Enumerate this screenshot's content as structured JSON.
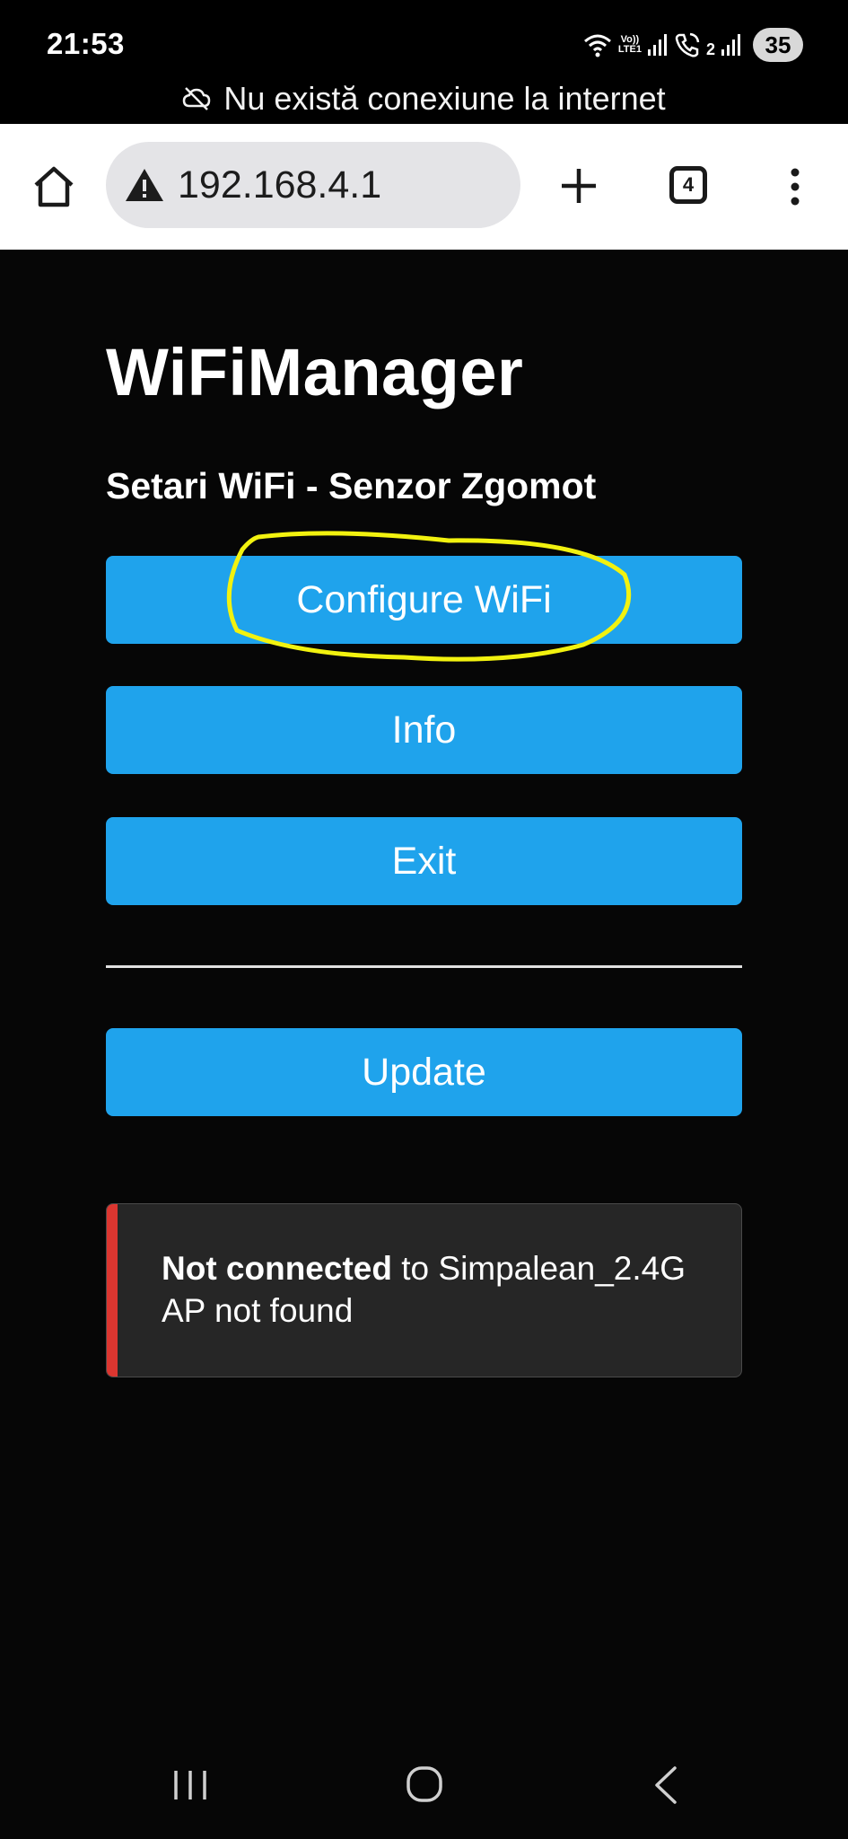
{
  "status_bar": {
    "time": "21:53",
    "battery": "35",
    "volte_top": "Vo))",
    "volte_bottom": "LTE1",
    "sim2_label": "2",
    "icons": [
      "wifi-icon",
      "volte-icon",
      "signal-icon",
      "wifi-calling-icon",
      "signal-icon",
      "battery-icon"
    ]
  },
  "offline_banner": {
    "icon": "cloud-off-icon",
    "text": "Nu există conexiune la internet"
  },
  "browser": {
    "url": "192.168.4.1",
    "tab_count": "4",
    "icons": [
      "home-icon",
      "warning-icon",
      "plus-icon",
      "tabs-icon",
      "more-vert-icon"
    ]
  },
  "page": {
    "title": "WiFiManager",
    "subtitle": "Setari WiFi - Senzor Zgomot",
    "buttons": {
      "configure": "Configure WiFi",
      "info": "Info",
      "exit": "Exit",
      "update": "Update"
    },
    "accent_color": "#1fa3ec",
    "message": {
      "status": "Not connected",
      "rest_line1": " to Simpalean_2.4G",
      "line2": "AP not found",
      "bar_color": "#dc3630"
    },
    "annotation_color": "#f2f20f"
  },
  "nav_bar": {
    "icons": [
      "recent-apps-icon",
      "home-nav-icon",
      "back-icon"
    ]
  }
}
